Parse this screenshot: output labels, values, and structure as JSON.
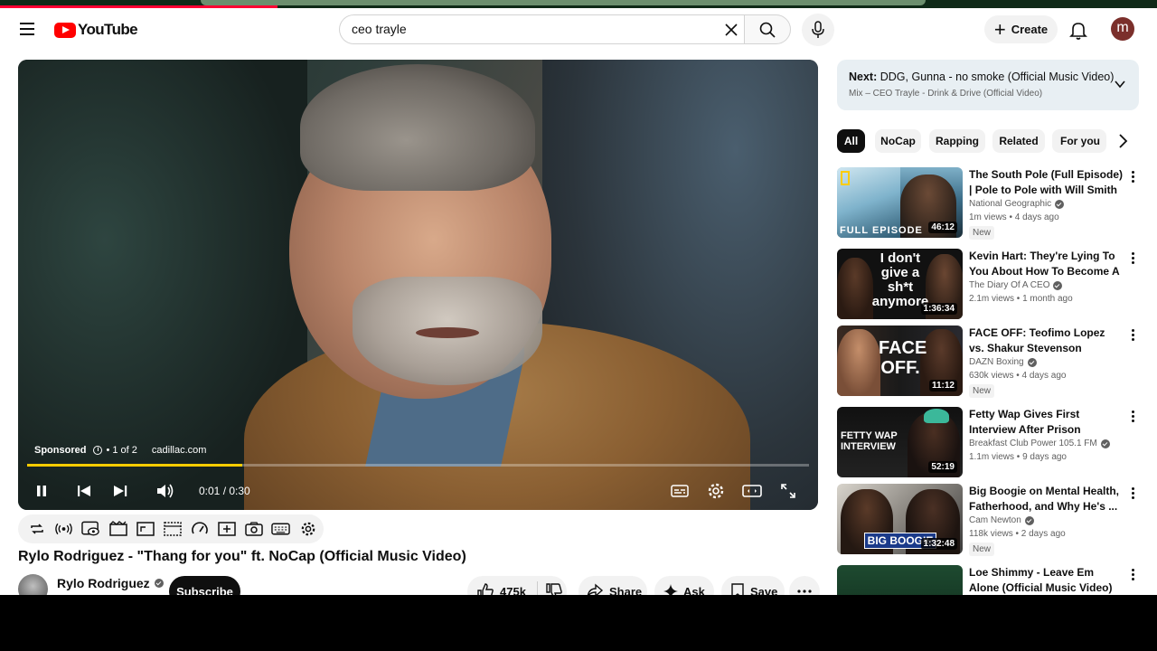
{
  "header": {
    "logo_text": "YouTube",
    "search_value": "ceo trayle",
    "create_label": "Create",
    "user_initial": "m"
  },
  "player": {
    "sponsored_label": "Sponsored",
    "ad_count": "• 1 of 2",
    "ad_domain": "cadillac.com",
    "time_current": "0:01",
    "time_total": "0:30",
    "progress_fraction": 0.275,
    "progress_color": "#ffcc00"
  },
  "video": {
    "title": "Rylo Rodriguez - \"Thang for you\" ft. NoCap (Official Music Video)",
    "channel_name": "Rylo Rodriguez",
    "subscribe_label": "Subscribe",
    "like_count": "475k",
    "share_label": "Share",
    "ask_label": "Ask",
    "save_label": "Save"
  },
  "up_next": {
    "label": "Next:",
    "title": "DDG, Gunna - no smoke (Official Music Video)",
    "mix_text": "Mix – CEO Trayle - Drink & Drive (Official Video)"
  },
  "chips": [
    "All",
    "NoCap",
    "Rapping",
    "Related",
    "For you"
  ],
  "recommendations": [
    {
      "title": "The South Pole (Full Episode) | Pole to Pole with Will Smith | ...",
      "channel": "National Geographic",
      "verified": true,
      "views": "1m views • 4 days ago",
      "badge": "New",
      "duration": "46:12",
      "thumb_text": "FULL EPISODE"
    },
    {
      "title": "Kevin Hart: They're Lying To You About How To Become A ...",
      "channel": "The Diary Of A CEO",
      "verified": true,
      "views": "2.1m views • 1 month ago",
      "badge": "",
      "duration": "1:36:34",
      "thumb_text": "I don't give a sh*t anymore"
    },
    {
      "title": "FACE OFF: Teofimo Lopez vs. Shakur Stevenson",
      "channel": "DAZN Boxing",
      "verified": true,
      "views": "630k views • 4 days ago",
      "badge": "New",
      "duration": "11:12",
      "thumb_text": "FACE OFF."
    },
    {
      "title": "Fetty Wap Gives First Interview After Prison Release",
      "channel": "Breakfast Club Power 105.1 FM",
      "verified": true,
      "views": "1.1m views • 9 days ago",
      "badge": "",
      "duration": "52:19",
      "thumb_text": "FETTY WAP INTERVIEW"
    },
    {
      "title": "Big Boogie on Mental Health, Fatherhood, and Why He's ...",
      "channel": "Cam Newton",
      "verified": true,
      "views": "118k views • 2 days ago",
      "badge": "New",
      "duration": "1:32:48",
      "thumb_text": "BIG BOOGIE"
    },
    {
      "title": "Loe Shimmy - Leave Em Alone (Official Music Video)",
      "channel": "",
      "verified": false,
      "views": "",
      "badge": "",
      "duration": "",
      "thumb_text": ""
    }
  ]
}
